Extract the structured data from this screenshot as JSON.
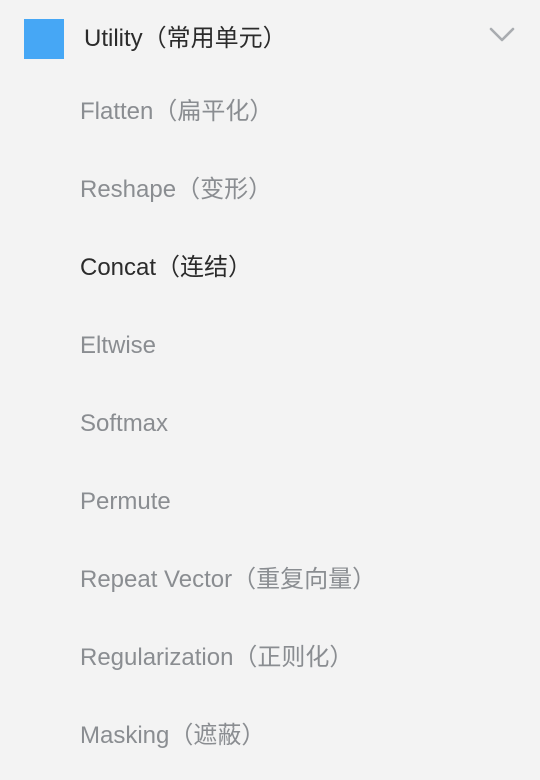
{
  "category": {
    "title": "Utility（常用单元）",
    "swatch_color": "#46a7f5",
    "expanded": true,
    "chevron_icon": "chevron-down-icon"
  },
  "items": [
    {
      "label": "Flatten（扁平化）",
      "active": false
    },
    {
      "label": "Reshape（变形）",
      "active": false
    },
    {
      "label": "Concat（连结）",
      "active": true
    },
    {
      "label": "Eltwise",
      "active": false
    },
    {
      "label": "Softmax",
      "active": false
    },
    {
      "label": "Permute",
      "active": false
    },
    {
      "label": "Repeat Vector（重复向量）",
      "active": false
    },
    {
      "label": "Regularization（正则化）",
      "active": false
    },
    {
      "label": "Masking（遮蔽）",
      "active": false
    }
  ],
  "colors": {
    "background": "#f3f3f3",
    "text_active": "#2b2b2b",
    "text_inactive": "#8a8d91",
    "chevron": "#a9acb0"
  }
}
